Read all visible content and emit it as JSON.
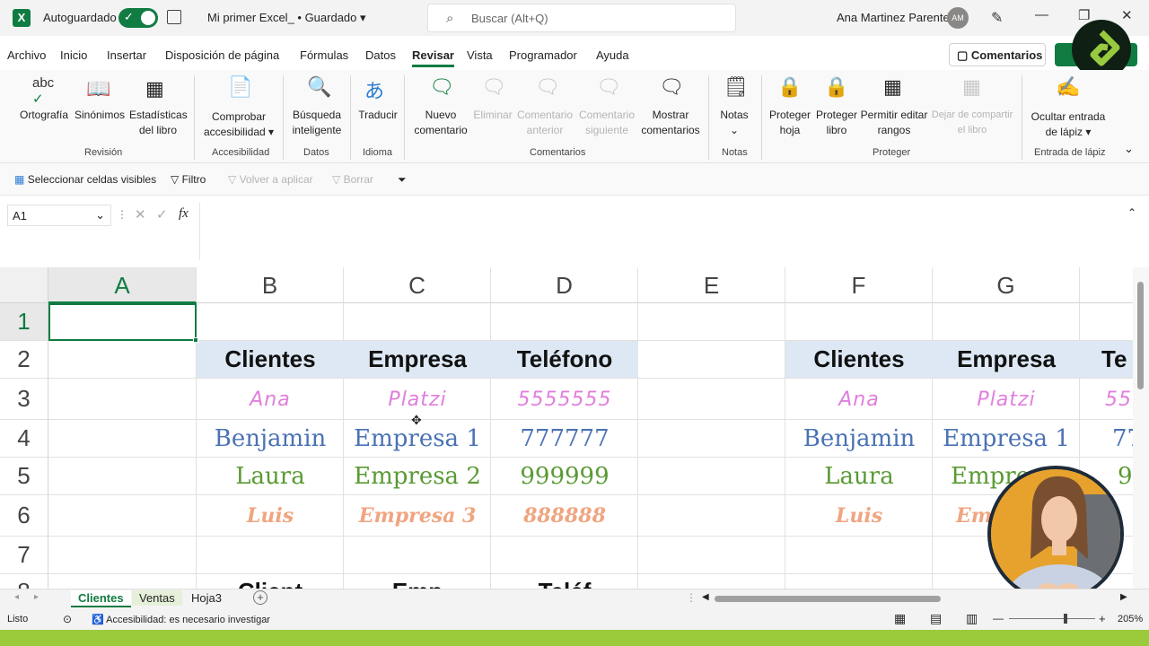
{
  "titlebar": {
    "autosave_label": "Autoguardado",
    "doc_name": "Mi primer Excel_ • Guardado",
    "search_placeholder": "Buscar (Alt+Q)",
    "user_name": "Ana Martinez Parente",
    "user_initials": "AM"
  },
  "menu": {
    "tabs": [
      "Archivo",
      "Inicio",
      "Insertar",
      "Disposición de página",
      "Fórmulas",
      "Datos",
      "Revisar",
      "Vista",
      "Programador",
      "Ayuda"
    ],
    "active": "Revisar",
    "comments_button": "Comentarios"
  },
  "ribbon": {
    "buttons": {
      "ortografia": "Ortografía",
      "sinonimos": "Sinónimos",
      "estadisticas": "Estadísticas del libro",
      "comprobar": "Comprobar accesibilidad",
      "busqueda": "Búsqueda inteligente",
      "traducir": "Traducir",
      "nuevo": "Nuevo comentario",
      "eliminar": "Eliminar",
      "anterior": "Comentario anterior",
      "siguiente": "Comentario siguiente",
      "mostrar": "Mostrar comentarios",
      "notas": "Notas",
      "proteger_hoja": "Proteger hoja",
      "proteger_libro": "Proteger libro",
      "permitir": "Permitir editar rangos",
      "dejar": "Dejar de compartir el libro",
      "ocultar": "Ocultar entrada de lápiz"
    },
    "groups": {
      "revision": "Revisión",
      "accesibilidad": "Accesibilidad",
      "datos": "Datos",
      "idioma": "Idioma",
      "comentarios": "Comentarios",
      "notas": "Notas",
      "proteger": "Proteger",
      "lapiz": "Entrada de lápiz"
    }
  },
  "filterbar": {
    "select_visible": "Seleccionar celdas visibles",
    "filtro": "Filtro",
    "volver": "Volver a aplicar",
    "borrar": "Borrar"
  },
  "formula": {
    "name_box": "A1",
    "fx": "fx"
  },
  "grid": {
    "columns": [
      "A",
      "B",
      "C",
      "D",
      "E",
      "F",
      "G"
    ],
    "rows": [
      "1",
      "2",
      "3",
      "4",
      "5",
      "6",
      "7",
      "8"
    ],
    "table1": {
      "headers": [
        "Clientes",
        "Empresa",
        "Teléfono"
      ],
      "r3": [
        "Ana",
        "Platzi",
        "5555555"
      ],
      "r4": [
        "Benjamin",
        "Empresa 1",
        "777777"
      ],
      "r5": [
        "Laura",
        "Empresa 2",
        "999999"
      ],
      "r6": [
        "Luis",
        "Empresa 3",
        "888888"
      ]
    },
    "table2": {
      "headers": [
        "Clientes",
        "Empresa",
        "Te"
      ],
      "r3": [
        "Ana",
        "Platzi",
        "55"
      ],
      "r4": [
        "Benjamin",
        "Empresa 1",
        "77"
      ],
      "r5": [
        "Laura",
        "Empres",
        "9"
      ],
      "r6": [
        "Luis",
        "Em",
        ""
      ]
    },
    "row8": [
      "Client",
      "Emp",
      "Teléf"
    ]
  },
  "sheets": {
    "tabs": [
      "Clientes",
      "Ventas",
      "Hoja3"
    ],
    "active": "Clientes"
  },
  "status": {
    "ready": "Listo",
    "accessibility": "Accesibilidad: es necesario investigar",
    "zoom": "205%"
  }
}
